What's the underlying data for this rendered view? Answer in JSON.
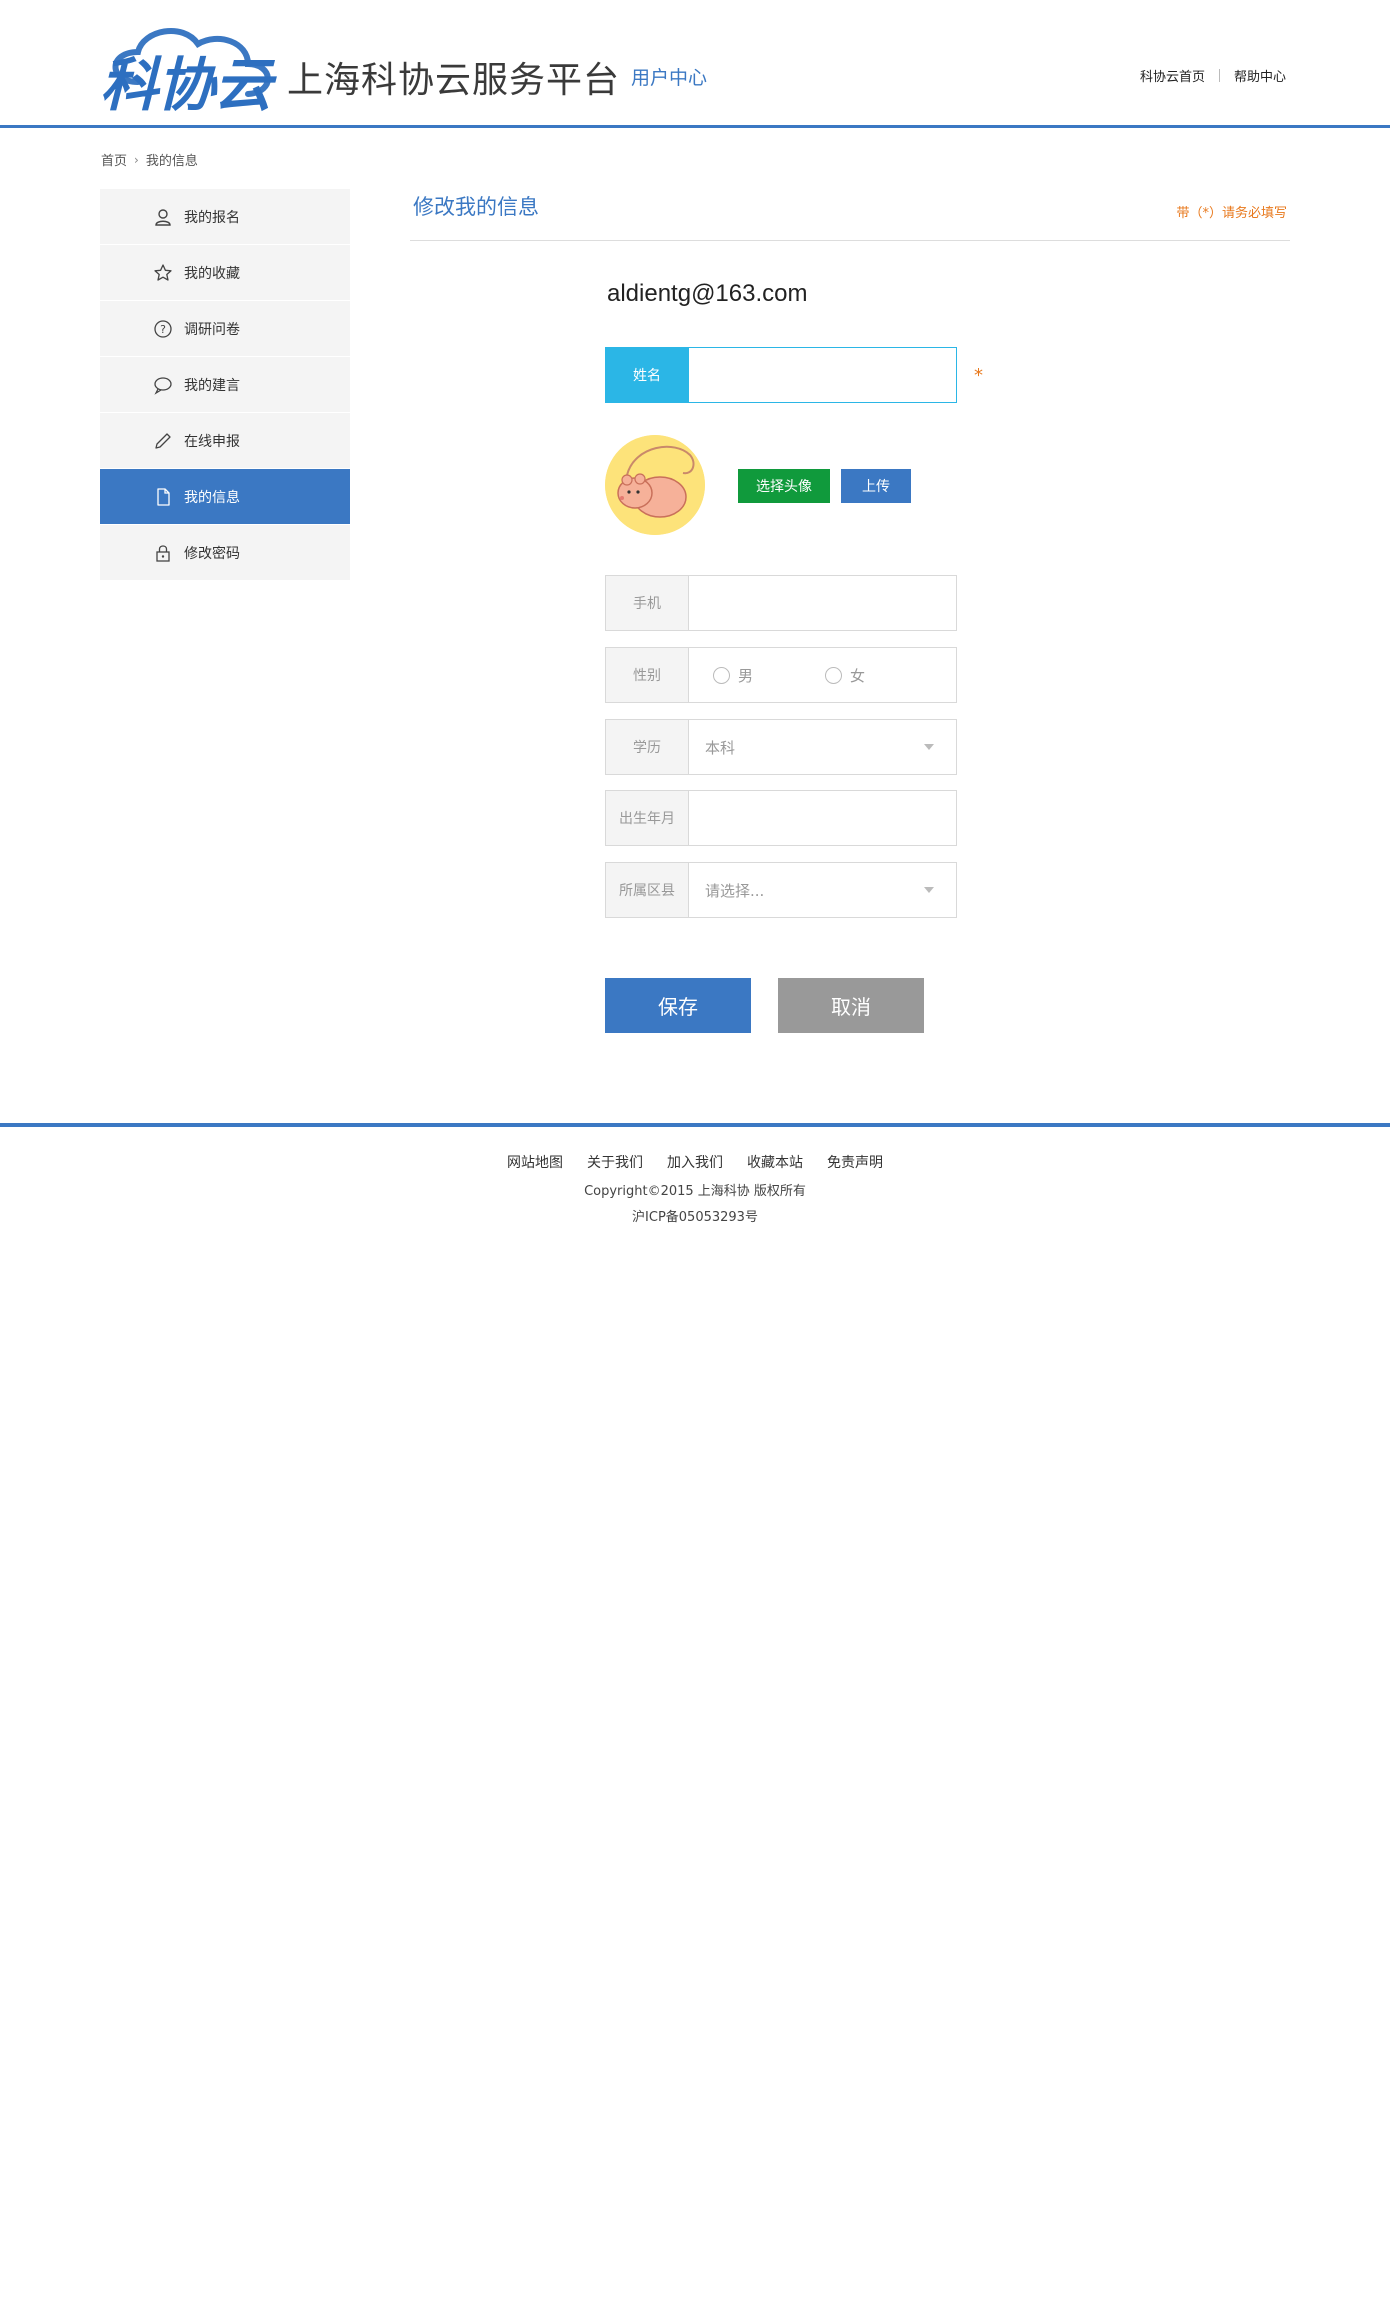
{
  "header": {
    "logo_text": "科协云",
    "site_title": "上海科协云服务平台",
    "sub_title": "用户中心",
    "links": [
      "科协云首页",
      "帮助中心"
    ]
  },
  "breadcrumb": {
    "home": "首页",
    "current": "我的信息"
  },
  "sidebar": {
    "items": [
      {
        "label": "我的报名",
        "icon": "user-icon"
      },
      {
        "label": "我的收藏",
        "icon": "star-icon"
      },
      {
        "label": "调研问卷",
        "icon": "question-icon"
      },
      {
        "label": "我的建言",
        "icon": "speech-bubble-icon"
      },
      {
        "label": "在线申报",
        "icon": "pencil-icon"
      },
      {
        "label": "我的信息",
        "icon": "document-icon",
        "active": true
      },
      {
        "label": "修改密码",
        "icon": "lock-icon"
      }
    ]
  },
  "main": {
    "title": "修改我的信息",
    "required_note": "带（*）请务必填写",
    "email": "aldientg@163.com",
    "name_label": "姓名",
    "name_value": "",
    "asterisk": "*",
    "choose_avatar": "选择头像",
    "upload": "上传",
    "phone_label": "手机",
    "phone_value": "",
    "gender_label": "性别",
    "gender_options": [
      "男",
      "女"
    ],
    "education_label": "学历",
    "education_value": "本科",
    "birth_label": "出生年月",
    "birth_value": "",
    "district_label": "所属区县",
    "district_placeholder": "请选择...",
    "save": "保存",
    "cancel": "取消"
  },
  "footer": {
    "links": [
      "网站地图",
      "关于我们",
      "加入我们",
      "收藏本站",
      "免责声明"
    ],
    "copyright": "Copyright©2015 上海科协 版权所有",
    "icp": "沪ICP备05053293号"
  },
  "colors": {
    "brand_blue": "#3b78c3",
    "cyan": "#2bb6e6",
    "green": "#109a3c",
    "orange": "#e8791d",
    "gray_button": "#999999"
  }
}
